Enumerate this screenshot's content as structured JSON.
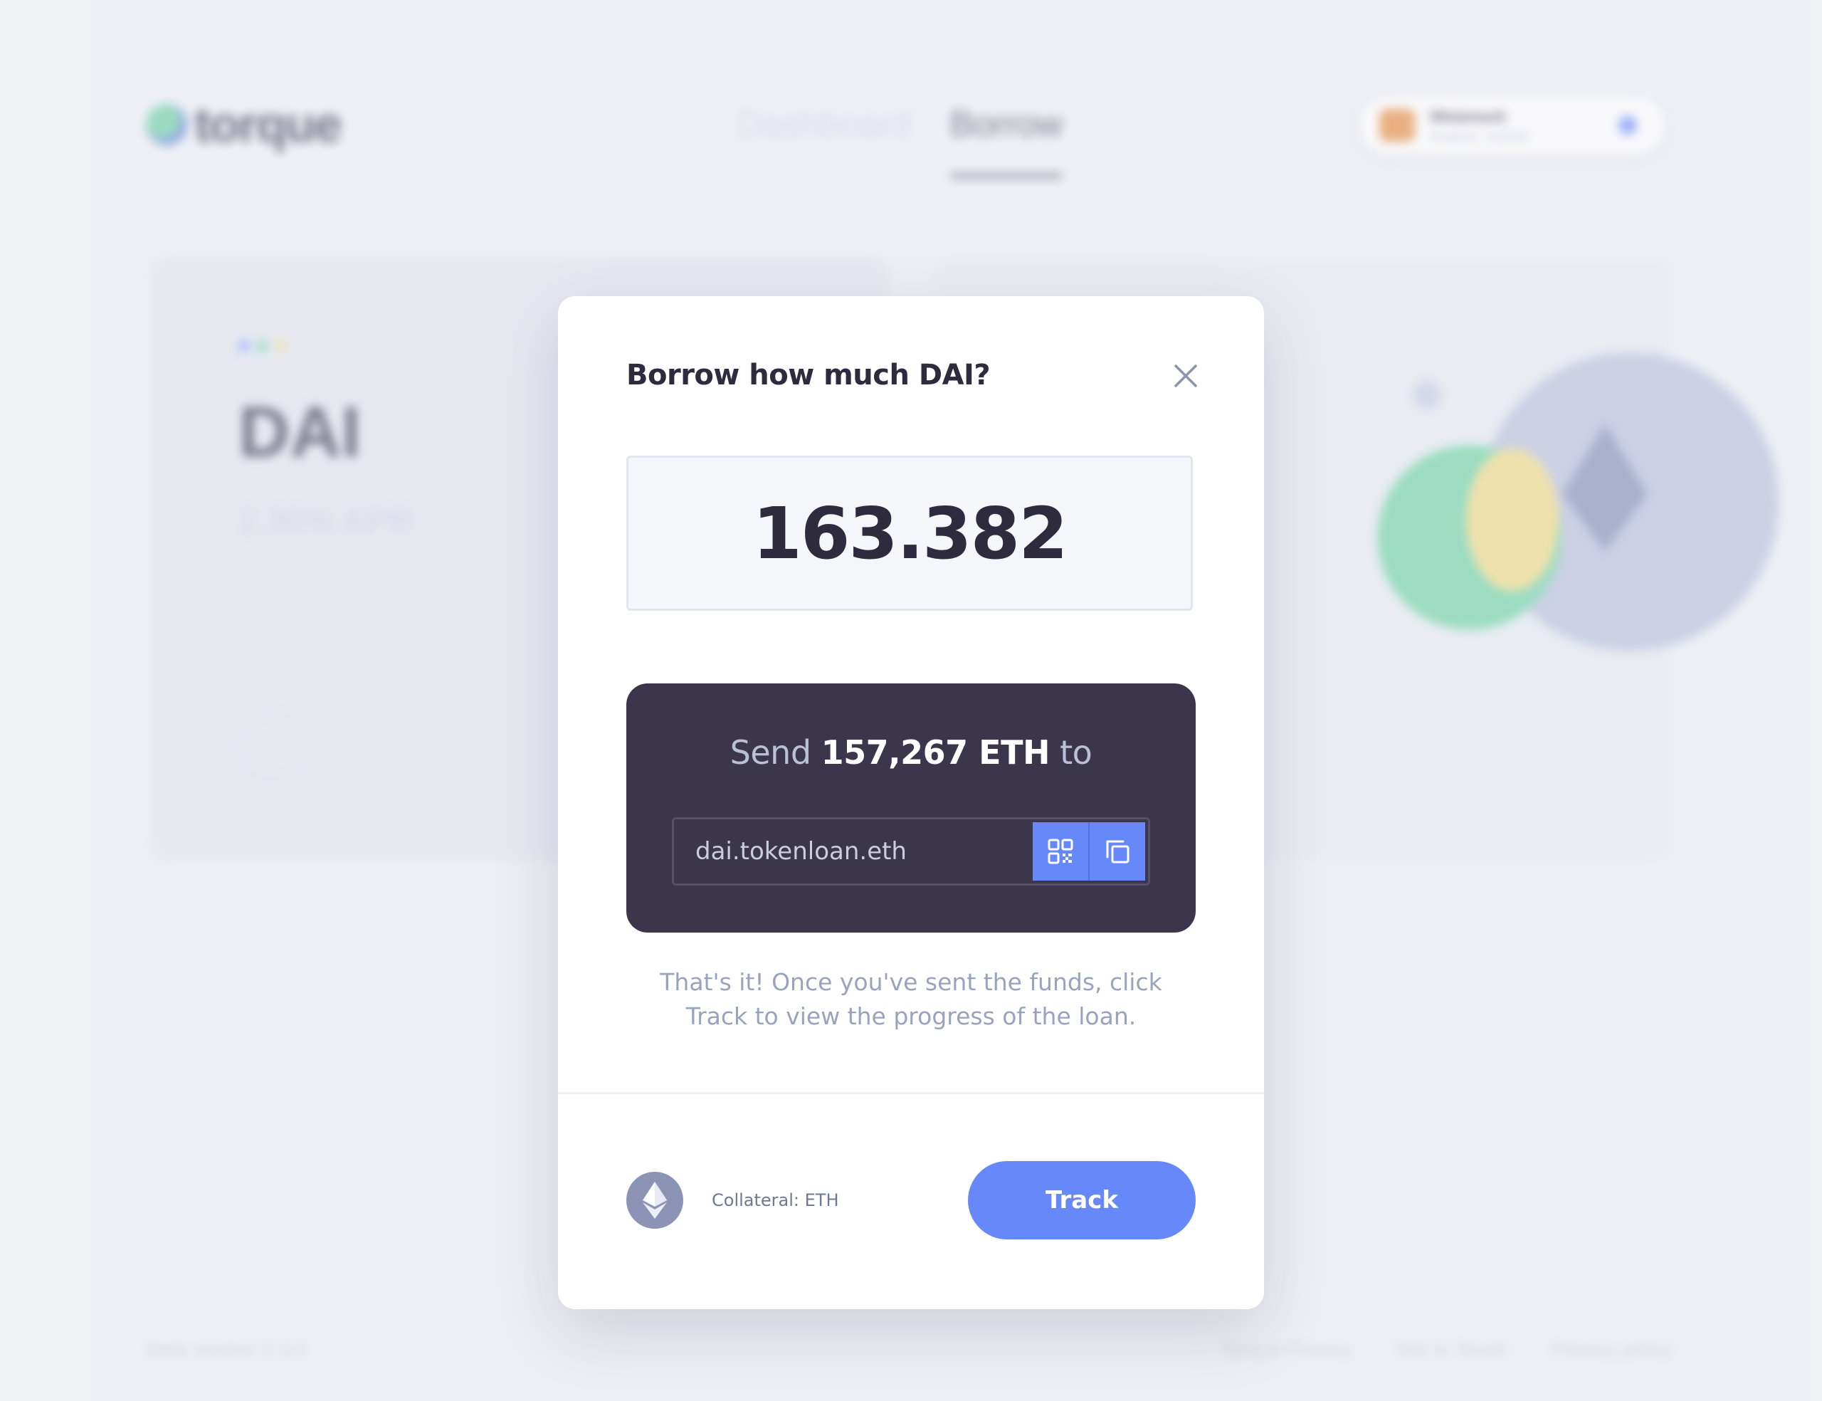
{
  "background": {
    "logo_text": "torque",
    "nav": {
      "dashboard": "Dashboard",
      "borrow": "Borrow"
    },
    "wallet": {
      "name": "Metamask",
      "address": "0xabcd...eterter"
    },
    "token_symbol": "DAI",
    "token_apr": "2.30% APR",
    "footer_left": "Beta version 0.4.0",
    "footer_links": [
      "Torque Privacy",
      "Get In Touch",
      "Privacy policy"
    ],
    "accent_dots": [
      "#7c9bff",
      "#6ed3a6",
      "#f0da83"
    ]
  },
  "modal": {
    "title": "Borrow how much DAI?",
    "amount_value": "163.382",
    "send": {
      "prefix": "Send",
      "amount": "157,267 ETH",
      "suffix": "to",
      "address": "dai.tokenloan.eth"
    },
    "hint": "That's it! Once you've sent the funds, click Track to view the progress of the loan.",
    "collateral_label": "Collateral: ETH",
    "track_label": "Track",
    "colors": {
      "accent": "#6788f8",
      "panel": "#3c364c",
      "title": "#2d2b3d",
      "muted": "#9aa3bd"
    },
    "icons": {
      "close": "close-icon",
      "qr": "qr-code-icon",
      "copy": "copy-icon",
      "eth": "ethereum-icon"
    }
  }
}
